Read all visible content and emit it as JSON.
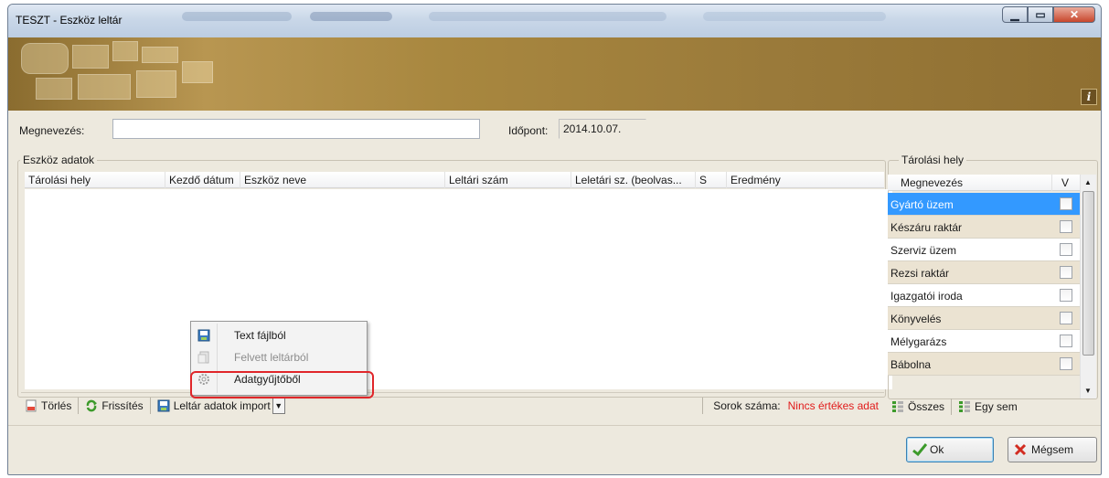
{
  "window": {
    "title": "TESZT - Eszköz leltár"
  },
  "form": {
    "name_label": "Megnevezés:",
    "name_value": "",
    "time_label": "Időpont:",
    "time_value": "2014.10.07."
  },
  "assets_group": {
    "title": "Eszköz adatok",
    "columns": [
      "Tárolási hely",
      "Kezdő dátum",
      "Eszköz neve",
      "Leltári szám",
      "Leletári sz. (beolvas...",
      "S",
      "Eredmény"
    ]
  },
  "toolbar": {
    "delete_label": "Törlés",
    "refresh_label": "Frissítés",
    "import_label": "Leltár adatok import",
    "rowcount_label": "Sorok száma:",
    "rowcount_value": "Nincs értékes adat"
  },
  "import_menu": {
    "items": [
      {
        "label": "Text fájlból",
        "enabled": true
      },
      {
        "label": "Felvett leltárból",
        "enabled": false
      },
      {
        "label": "Adatgyűjtőből",
        "enabled": true,
        "highlighted": true
      }
    ]
  },
  "storage_group": {
    "title": "Tárolási hely",
    "columns": [
      "Megnevezés",
      "V"
    ],
    "rows": [
      {
        "name": "Gyártó üzem",
        "selected": true,
        "checked": false
      },
      {
        "name": "Készáru raktár",
        "selected": false,
        "checked": false
      },
      {
        "name": "Szerviz üzem",
        "selected": false,
        "checked": false
      },
      {
        "name": "Rezsi raktár",
        "selected": false,
        "checked": false
      },
      {
        "name": "Igazgatói iroda",
        "selected": false,
        "checked": false
      },
      {
        "name": "Könyvelés",
        "selected": false,
        "checked": false
      },
      {
        "name": "Mélygarázs",
        "selected": false,
        "checked": false
      },
      {
        "name": "Bábolna",
        "selected": false,
        "checked": false
      }
    ],
    "all_label": "Összes",
    "none_label": "Egy sem"
  },
  "buttons": {
    "ok_label": "Ok",
    "cancel_label": "Mégsem"
  },
  "colors": {
    "selection": "#3399ff",
    "row_alt": "#ebe3d2",
    "rowcount_value": "#e11b1b",
    "highlight_frame": "#e0262a"
  }
}
